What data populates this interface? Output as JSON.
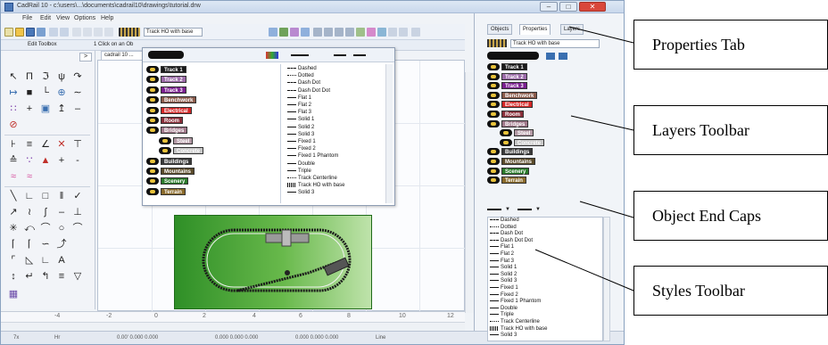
{
  "window": {
    "title": "CadRail 10 - c:\\users\\...\\documents\\cadrail10\\drawings\\tutorial.drw",
    "minimize": "–",
    "maximize": "□",
    "close": "✕"
  },
  "menu": [
    "File",
    "Edit",
    "View",
    "Options",
    "Help"
  ],
  "toolbar": {
    "layer_combo": "Track HO with base",
    "layer_combo_right": "Track HO with base"
  },
  "panels": {
    "toolbox_label": "Edit Toolbox",
    "hint_label": "1 Click on an Ob",
    "drawing_tab": "cadrail 10 ..."
  },
  "layers": [
    {
      "label": "Track 1",
      "color": "#1a1a1a"
    },
    {
      "label": "Track 2",
      "color": "#9b6aa8"
    },
    {
      "label": "Track 3",
      "color": "#7a1f8f"
    },
    {
      "label": "Benchwork",
      "color": "#8a5a4a"
    },
    {
      "label": "Electrical",
      "color": "#d32626"
    },
    {
      "label": "Room",
      "color": "#8a2f3a"
    },
    {
      "label": "Bridges",
      "color": "#a0788a"
    },
    {
      "label": "Steel",
      "color": "#b49aa6"
    },
    {
      "label": "Concrete",
      "color": "#c7c7c7"
    },
    {
      "label": "Buildings",
      "color": "#3a3a3a"
    },
    {
      "label": "Mountains",
      "color": "#5a4a2a"
    },
    {
      "label": "Scenery",
      "color": "#2a7a2a"
    },
    {
      "label": "Terrain",
      "color": "#8a6a2a"
    }
  ],
  "styles": [
    "Dashed",
    "Dotted",
    "Dash Dot",
    "Dash Dot Dot",
    "Flat 1",
    "Flat 2",
    "Flat 3",
    "Solid 1",
    "Solid 2",
    "Solid 3",
    "Fixed 1",
    "Fixed 2",
    "Fixed 1 Phantom",
    "Double",
    "Triple",
    "Track Centerline",
    "Track HO with base",
    "Solid 3"
  ],
  "dock": {
    "tab_objects": "Objects",
    "tab_properties": "Properties",
    "tab_layers": "Layers"
  },
  "ruler": [
    "-4",
    "-2",
    "0",
    "2",
    "4",
    "6",
    "8",
    "10",
    "12"
  ],
  "status": {
    "zoom": "7x",
    "snap": "Hr",
    "coords1": "0.00' 0.000 0.000",
    "coords2": "0.000 0.000 0.000",
    "coords3": "0.000 0.000 0.000",
    "mode": "Line"
  },
  "callouts": {
    "properties_tab": "Properties Tab",
    "layers_toolbar": "Layers Toolbar",
    "object_end_caps": "Object End Caps",
    "styles_toolbar": "Styles Toolbar"
  },
  "colors": {
    "board_green": "#3d9a31",
    "track": "#1a1a1a",
    "callout_border": "#000000"
  }
}
